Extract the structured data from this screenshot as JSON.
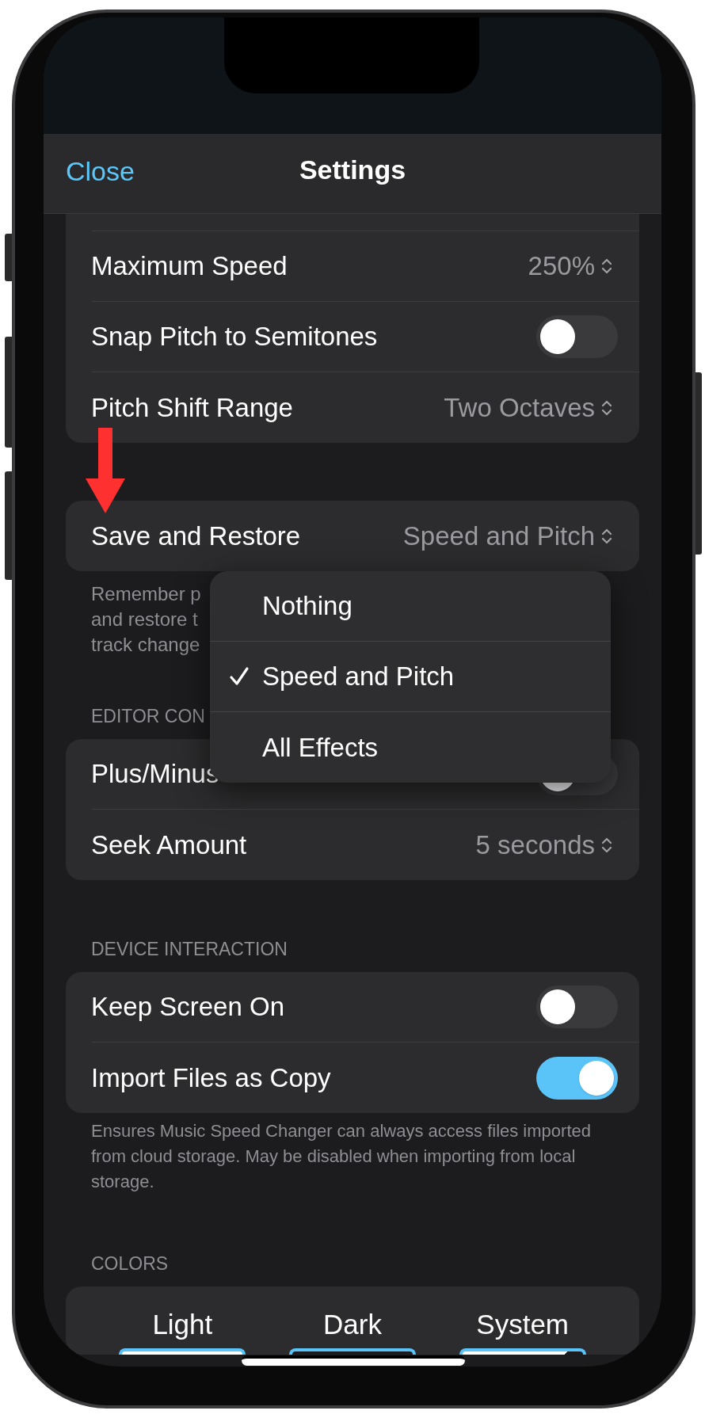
{
  "nav": {
    "close": "Close",
    "title": "Settings"
  },
  "sections": [
    {
      "rows": [
        {
          "kind": "value",
          "label": "Maximum Speed",
          "value": "250%"
        },
        {
          "kind": "toggle",
          "label": "Snap Pitch to Semitones",
          "on": false
        },
        {
          "kind": "value",
          "label": "Pitch Shift Range",
          "value": "Two Octaves"
        }
      ]
    },
    {
      "rows": [
        {
          "kind": "value",
          "label": "Save and Restore",
          "value": "Speed and Pitch"
        }
      ],
      "footer_lines": [
        "Remember p",
        "and restore t",
        "track change"
      ]
    },
    {
      "header": "EDITOR CON",
      "rows": [
        {
          "kind": "toggle",
          "label": "Plus/Minus",
          "on": false
        },
        {
          "kind": "value",
          "label": "Seek Amount",
          "value": "5 seconds"
        }
      ]
    },
    {
      "header": "DEVICE INTERACTION",
      "rows": [
        {
          "kind": "toggle",
          "label": "Keep Screen On",
          "on": false
        },
        {
          "kind": "toggle",
          "label": "Import Files as Copy",
          "on": true
        }
      ],
      "footer": "Ensures Music Speed Changer can always access files imported from cloud storage. May be disabled when importing from local storage."
    },
    {
      "header": "COLORS",
      "themes": [
        {
          "label": "Light",
          "kind": "light"
        },
        {
          "label": "Dark",
          "kind": "dark"
        },
        {
          "label": "System",
          "kind": "system"
        }
      ]
    }
  ],
  "menu": {
    "items": [
      {
        "label": "Nothing",
        "selected": false
      },
      {
        "label": "Speed and Pitch",
        "selected": true
      },
      {
        "label": "All Effects",
        "selected": false
      }
    ]
  }
}
